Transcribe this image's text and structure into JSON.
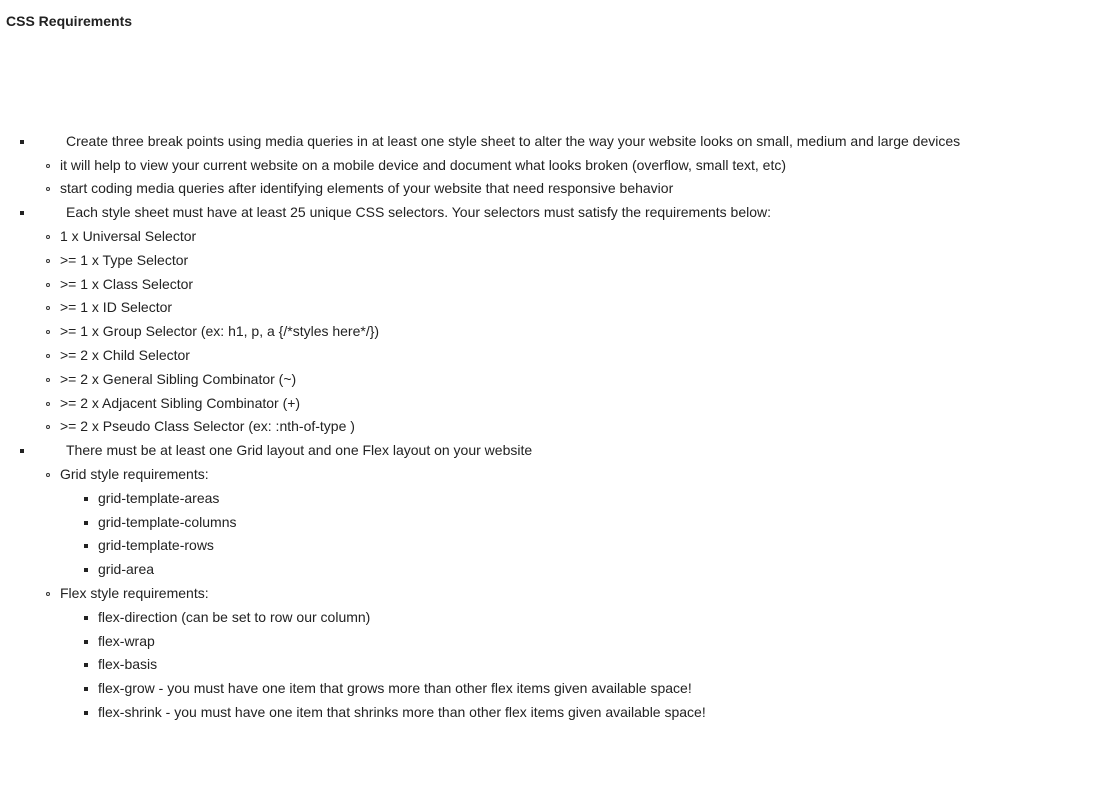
{
  "heading": "CSS Requirements",
  "items": [
    {
      "text": "Create three break points using media queries in at least one style sheet to alter the way your website looks on small, medium and large devices",
      "children": [
        {
          "text": "it will help to view your current website on a mobile device and document what looks broken (overflow, small text, etc)"
        },
        {
          "text": "start coding media queries after identifying elements of your website that need responsive behavior"
        }
      ]
    },
    {
      "text": "Each style sheet must have at least 25 unique CSS selectors. Your selectors must satisfy the requirements below:",
      "children": [
        {
          "text": "1 x Universal Selector"
        },
        {
          "text": ">= 1 x Type Selector"
        },
        {
          "text": ">= 1 x Class Selector"
        },
        {
          "text": ">= 1 x ID Selector"
        },
        {
          "text": ">= 1 x Group Selector (ex: h1, p, a {/*styles here*/})"
        },
        {
          "text": ">= 2 x Child Selector"
        },
        {
          "text": ">= 2 x General Sibling Combinator (~)"
        },
        {
          "text": ">= 2 x Adjacent Sibling Combinator (+)"
        },
        {
          "text": ">= 2 x Pseudo Class Selector (ex: :nth-of-type )"
        }
      ]
    },
    {
      "text": "There must be at least one Grid layout and one Flex layout on your website",
      "children": [
        {
          "text": "Grid style requirements:",
          "children": [
            {
              "text": "grid-template-areas"
            },
            {
              "text": "grid-template-columns"
            },
            {
              "text": "grid-template-rows"
            },
            {
              "text": "grid-area"
            }
          ]
        },
        {
          "text": "Flex style requirements:",
          "children": [
            {
              "text": "flex-direction (can be set to row our column)"
            },
            {
              "text": "flex-wrap"
            },
            {
              "text": "flex-basis"
            },
            {
              "text": "flex-grow - you must have one item that grows more than other flex items given available space!"
            },
            {
              "text": "flex-shrink - you must have one item that shrinks more than other flex items given available space!"
            }
          ]
        }
      ]
    }
  ]
}
